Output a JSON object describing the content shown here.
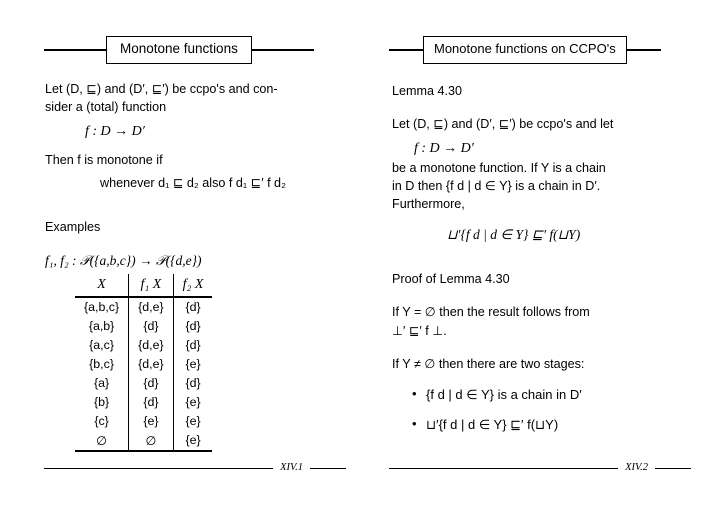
{
  "slides": [
    {
      "title": "Monotone functions",
      "footer": "XIV.1",
      "text": {
        "intro_line1": "Let (D, ⊑) and (D′, ⊑′) be ccpo's and con-",
        "intro_line2": "sider a (total) function",
        "display_fn": "f : D → D′",
        "then_line": "Then f is monotone if",
        "whenever_line": "whenever d₁ ⊑ d₂ also f d₁ ⊑′ f d₂",
        "examples_heading": "Examples",
        "signature": "f₁, f₂ : 𝒫({a,b,c}) → 𝒫({d,e})"
      },
      "table": {
        "headers": [
          "X",
          "f₁ X",
          "f₂ X"
        ],
        "rows": [
          [
            "{a,b,c}",
            "{d,e}",
            "{d}"
          ],
          [
            "{a,b}",
            "{d}",
            "{d}"
          ],
          [
            "{a,c}",
            "{d,e}",
            "{d}"
          ],
          [
            "{b,c}",
            "{d,e}",
            "{e}"
          ],
          [
            "{a}",
            "{d}",
            "{d}"
          ],
          [
            "{b}",
            "{d}",
            "{e}"
          ],
          [
            "{c}",
            "{e}",
            "{e}"
          ],
          [
            "∅",
            "∅",
            "{e}"
          ]
        ]
      }
    },
    {
      "title": "Monotone functions on CCPO's",
      "footer": "XIV.2",
      "text": {
        "lemma_heading": "Lemma 4.30",
        "lemma_line1": "Let (D, ⊑) and (D′, ⊑′) be ccpo's and let",
        "lemma_display_fn": "f : D → D′",
        "lemma_line2": "be a monotone function. If Y is a chain",
        "lemma_line3": "in D then {f d | d ∈ Y} is a chain in D′.",
        "lemma_line4": "Furthermore,",
        "lemma_display": "⊔′{f d | d ∈ Y} ⊑′ f(⊔Y)",
        "proof_heading": "Proof of Lemma 4.30",
        "proof_line1": "If Y = ∅ then the result follows from",
        "proof_line2": "⊥′ ⊑′ f ⊥.",
        "proof_line3": "If Y ≠ ∅ then there are two stages:",
        "bullet1": "{f d | d ∈ Y} is a chain in D′",
        "bullet2": "⊔′{f d | d ∈ Y} ⊑′ f(⊔Y)"
      }
    }
  ]
}
